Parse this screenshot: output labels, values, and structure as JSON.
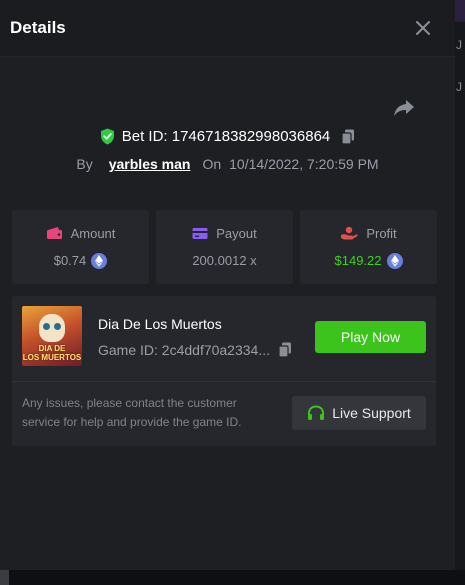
{
  "dialog": {
    "title": "Details"
  },
  "bet": {
    "id_text": "Bet ID: 1746718382998036864",
    "by_label": "By",
    "username": "yarbles man",
    "on_label": "On",
    "datetime": "10/14/2022, 7:20:59 PM"
  },
  "stats": [
    {
      "label": "Amount",
      "value": "$0.74",
      "icon": "wallet-icon"
    },
    {
      "label": "Payout",
      "value": "200.0012 x",
      "icon": "card-icon"
    },
    {
      "label": "Profit",
      "value": "$149.22",
      "icon": "hand-coin-icon"
    }
  ],
  "game": {
    "name": "Dia De Los Muertos",
    "id_text": "Game ID: 2c4ddf70a2334...",
    "thumbnail_text_line1": "DIA DE",
    "thumbnail_text_line2": "LOS MUERTOS",
    "play_label": "Play Now"
  },
  "support": {
    "help_text": "Any issues, please contact the customer service for help and provide the game ID.",
    "button_label": "Live Support"
  },
  "colors": {
    "accent_green": "#3cc31c",
    "profit_green": "#3ad31f",
    "shield_green": "#2ecc40",
    "amount_icon_pink": "#e8457a",
    "payout_icon_purple": "#8a5cf6",
    "profit_icon_red": "#e2504a",
    "eth_blue": "#6a7fd9"
  }
}
